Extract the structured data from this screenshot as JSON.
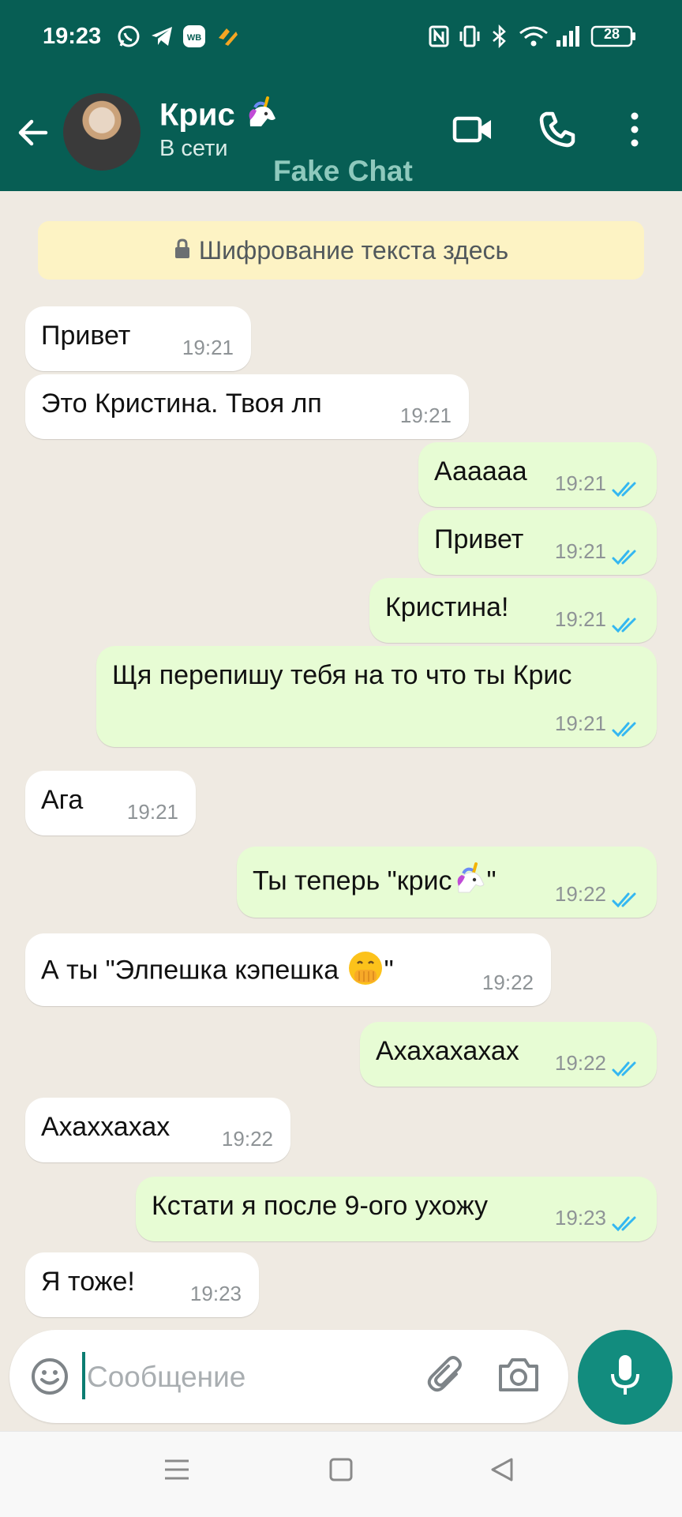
{
  "status_bar": {
    "time": "19:23",
    "left_icons": [
      "whatsapp-icon",
      "telegram-icon",
      "wb-app-icon",
      "app-icon"
    ],
    "wb_badge": "WB",
    "right_icons": [
      "nfc-icon",
      "vibrate-icon",
      "bluetooth-icon",
      "wifi-icon",
      "signal-icon"
    ],
    "battery": "28"
  },
  "header": {
    "contact_name": "Крис",
    "contact_emoji": "unicorn",
    "status": "В сети",
    "watermark": "Fake Chat"
  },
  "encryption_notice": "Шифрование текста здесь",
  "messages": [
    {
      "dir": "in",
      "text": "Привет",
      "time": "19:21"
    },
    {
      "dir": "in",
      "text": "Это Кристина. Твоя лп",
      "time": "19:21"
    },
    {
      "dir": "out",
      "text": "Аааааа",
      "time": "19:21",
      "read": true
    },
    {
      "dir": "out",
      "text": "Привет",
      "time": "19:21",
      "read": true
    },
    {
      "dir": "out",
      "text": "Кристина!",
      "time": "19:21",
      "read": true
    },
    {
      "dir": "out",
      "text": "Щя перепишу тебя на то что ты Крис",
      "time": "19:21",
      "read": true
    },
    {
      "dir": "in",
      "text": "Ага",
      "time": "19:21"
    },
    {
      "dir": "out",
      "text_before": "Ты теперь \"крис",
      "text_after": "\"",
      "emoji": "unicorn",
      "time": "19:22",
      "read": true
    },
    {
      "dir": "in",
      "text_before": "А ты \"Элпешка кэпешка ",
      "text_after": "\"",
      "emoji": "face-with-open-eyes-and-hand-over-mouth",
      "time": "19:22"
    },
    {
      "dir": "out",
      "text": "Ахахахахах",
      "time": "19:22",
      "read": true
    },
    {
      "dir": "in",
      "text": "Ахаххахах",
      "time": "19:22"
    },
    {
      "dir": "out",
      "text": "Кстати я после 9-ого ухожу",
      "time": "19:23",
      "read": true
    },
    {
      "dir": "in",
      "text": "Я тоже!",
      "time": "19:23"
    }
  ],
  "composer": {
    "placeholder": "Сообщение",
    "value": ""
  },
  "colors": {
    "header_bg": "#075e54",
    "chat_bg": "#efeae2",
    "incoming_bubble": "#ffffff",
    "outgoing_bubble": "#e7fcd4",
    "read_ticks": "#34b7f1",
    "mic_button": "#128c7e",
    "encryption_bg": "#fdf3c4"
  }
}
